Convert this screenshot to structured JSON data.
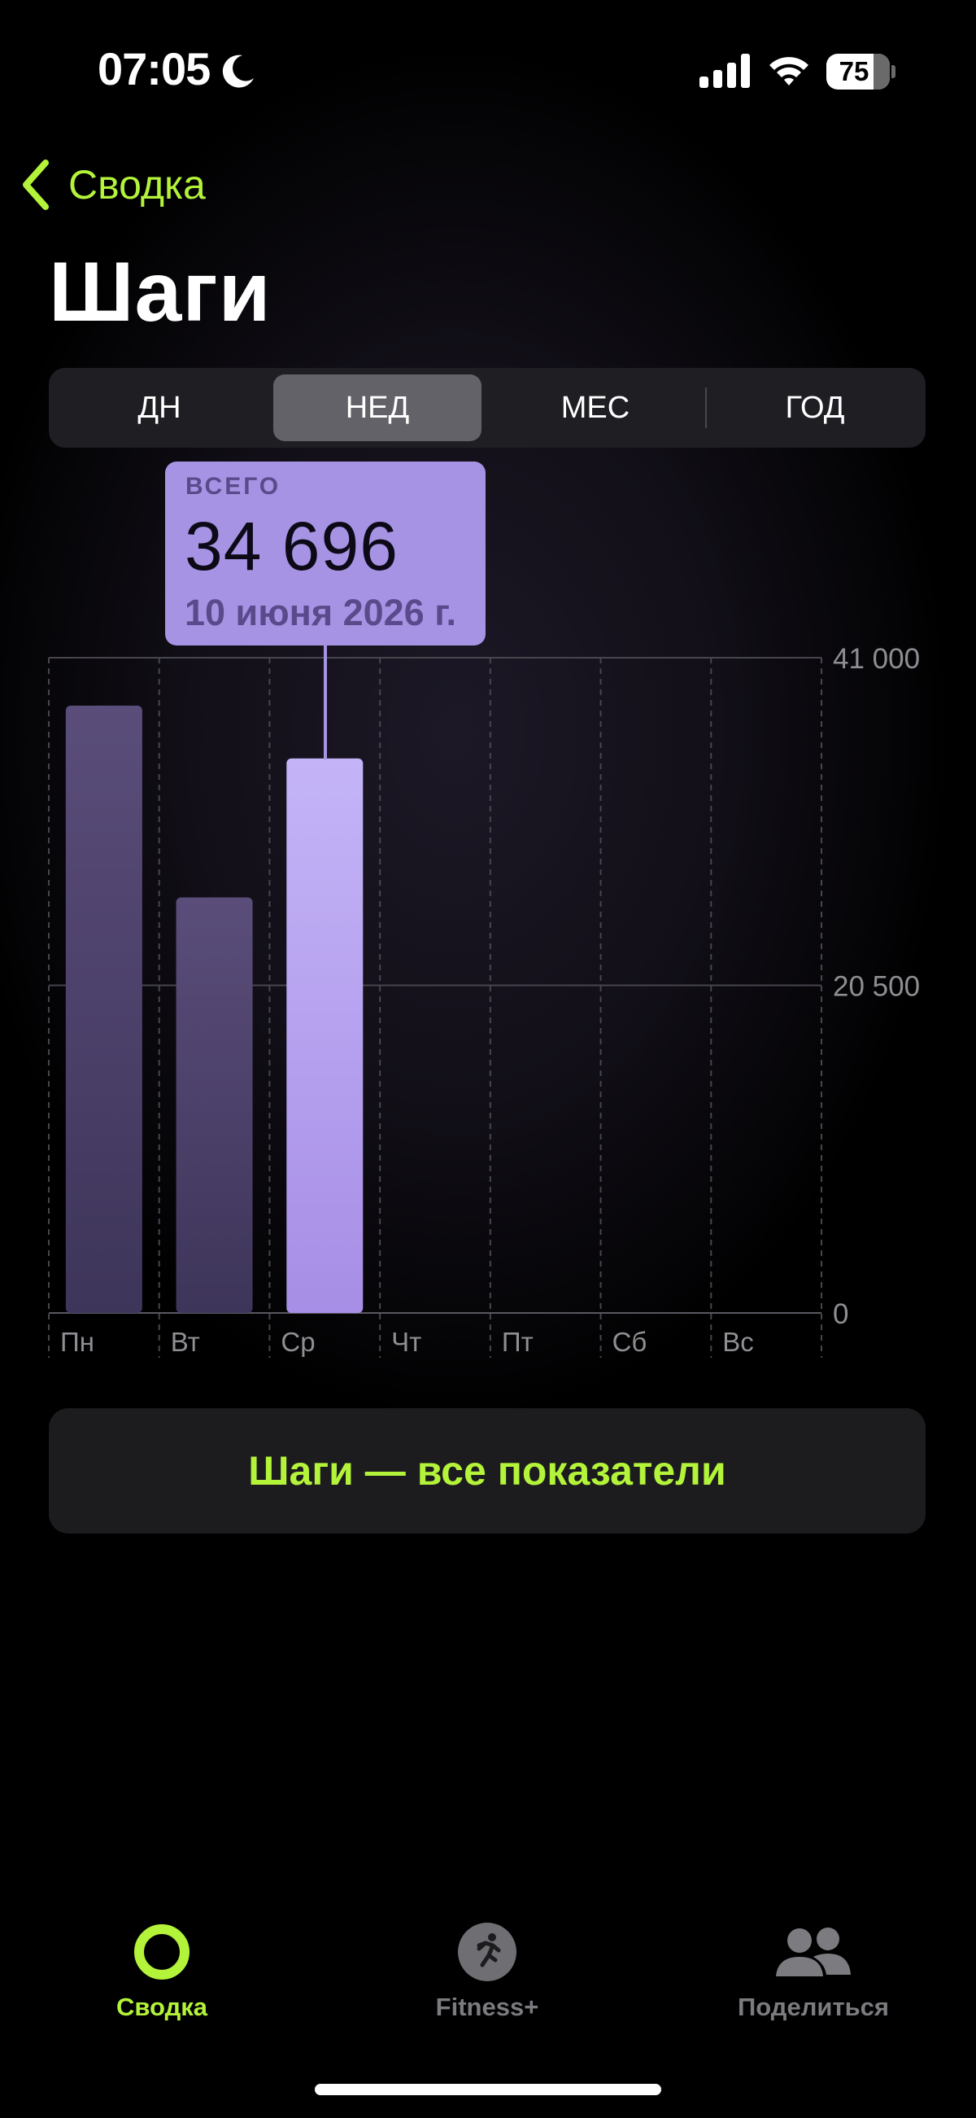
{
  "status_bar": {
    "time": "07:05",
    "battery": "75",
    "icons": [
      "moon-icon",
      "signal-icon",
      "wifi-icon",
      "battery-icon"
    ]
  },
  "nav": {
    "back_label": "Сводка",
    "back_icon": "chevron-left-icon"
  },
  "title": "Шаги",
  "segments": {
    "items": [
      {
        "label": "ДН",
        "selected": false
      },
      {
        "label": "НЕД",
        "selected": true
      },
      {
        "label": "МЕС",
        "selected": false
      },
      {
        "label": "ГОД",
        "selected": false
      }
    ]
  },
  "tooltip": {
    "label": "ВСЕГО",
    "value": "34 696",
    "date": "10 июня 2026 г."
  },
  "chart_data": {
    "type": "bar",
    "categories": [
      "Пн",
      "Вт",
      "Ср",
      "Чт",
      "Пт",
      "Сб",
      "Вс"
    ],
    "values": [
      38000,
      26000,
      34696,
      null,
      null,
      null,
      null
    ],
    "selected_index": 2,
    "ylim": [
      0,
      41000
    ],
    "yticks": [
      0,
      20500,
      41000
    ],
    "ytick_labels": [
      "0",
      "20 500",
      "41 000"
    ],
    "grid": true,
    "colors": {
      "bar": "#4a3f69",
      "bar_selected_top": "#c4b4f7",
      "bar_selected_bottom": "#a78ee6",
      "grid": "#47454d",
      "tick_label": "#8e8e93"
    }
  },
  "all_metrics_button": "Шаги — все показатели",
  "tab_bar": {
    "items": [
      {
        "label": "Сводка",
        "icon": "activity-ring-icon",
        "active": true
      },
      {
        "label": "Fitness+",
        "icon": "running-figure-icon",
        "active": false
      },
      {
        "label": "Поделиться",
        "icon": "people-icon",
        "active": false
      }
    ]
  },
  "colors": {
    "accent": "#b3f33a",
    "background": "#000000"
  }
}
